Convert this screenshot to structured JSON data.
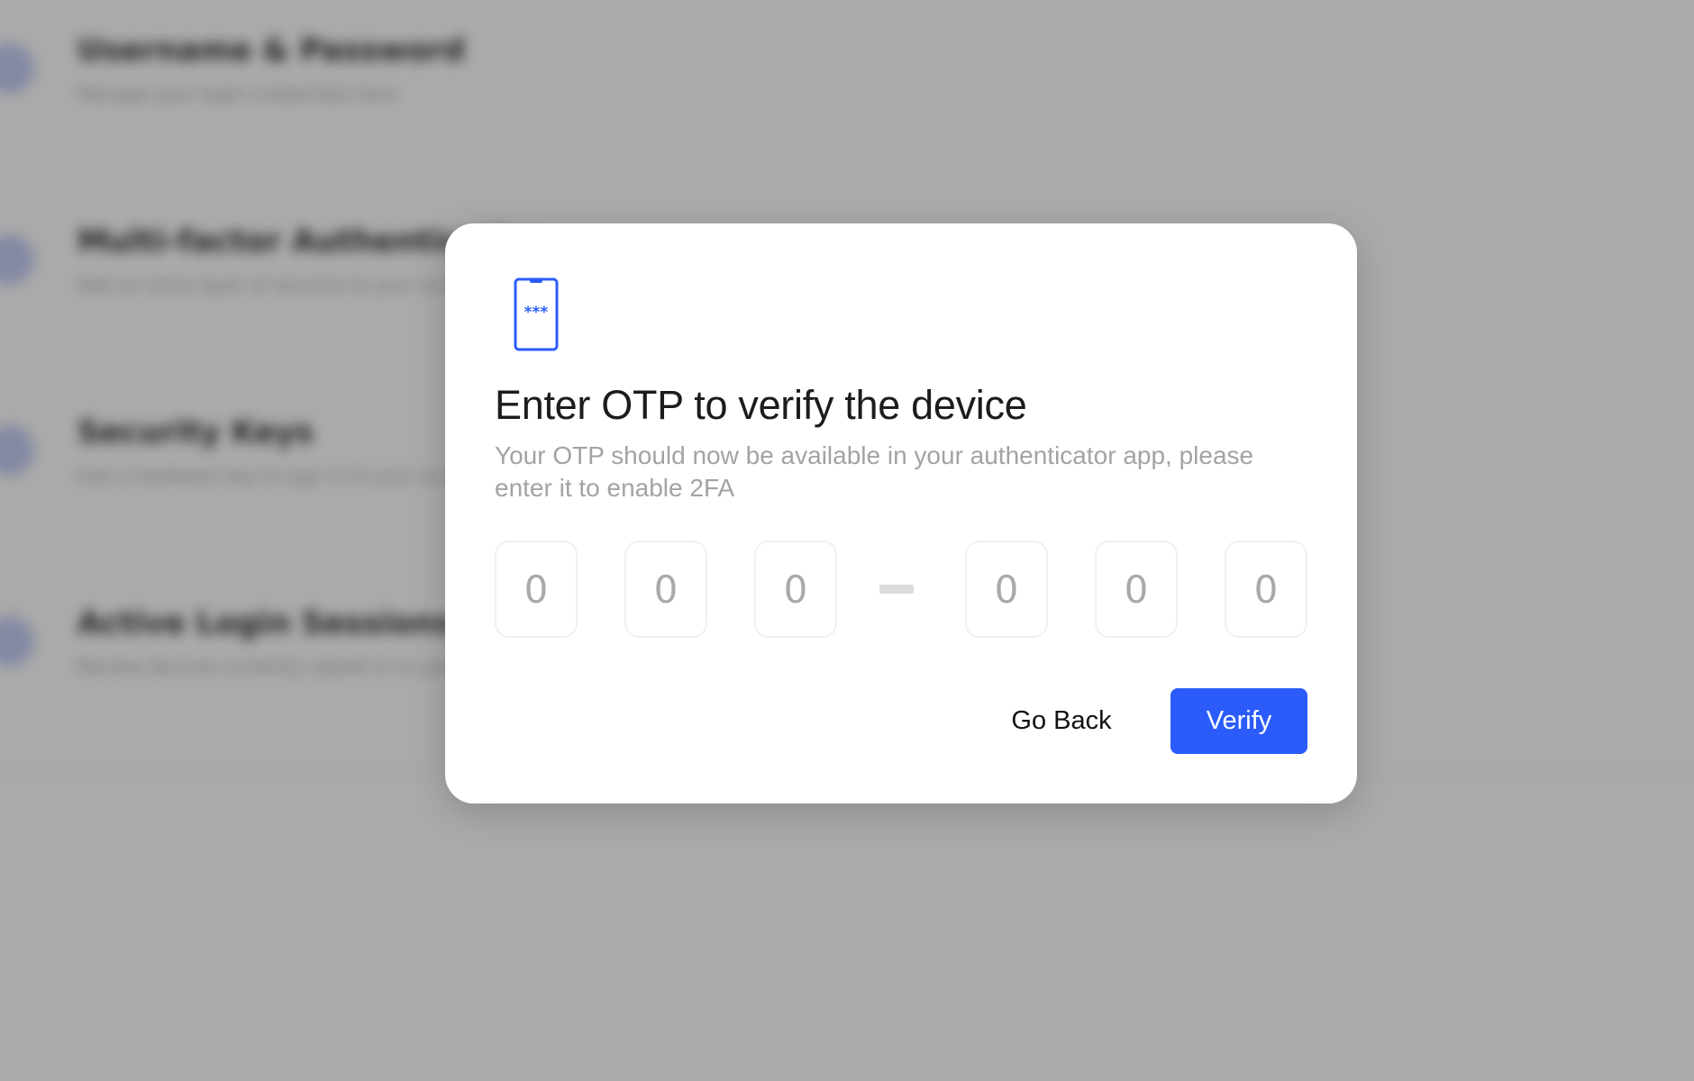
{
  "background": {
    "items": [
      {
        "title": "Username & Password",
        "subtitle": "Manage your login credentials here"
      },
      {
        "title": "Multi-factor Authentication",
        "subtitle": "Add an extra layer of security to your account"
      },
      {
        "title": "Security Keys",
        "subtitle": "Use a hardware key to sign in to your account"
      },
      {
        "title": "Active Login Sessions",
        "subtitle": "Review devices currently signed in to your account"
      }
    ]
  },
  "modal": {
    "icon": "phone-otp-icon",
    "icon_text": "***",
    "title": "Enter OTP to verify the device",
    "description": "Your OTP should now be available in your authenticator app, please enter it to enable 2FA",
    "otp": {
      "placeholder": "0",
      "digits": [
        "",
        "",
        "",
        "",
        "",
        ""
      ]
    },
    "go_back_label": "Go Back",
    "verify_label": "Verify"
  },
  "colors": {
    "accent": "#2b5cfb",
    "overlay": "rgba(40,40,40,0.36)"
  }
}
